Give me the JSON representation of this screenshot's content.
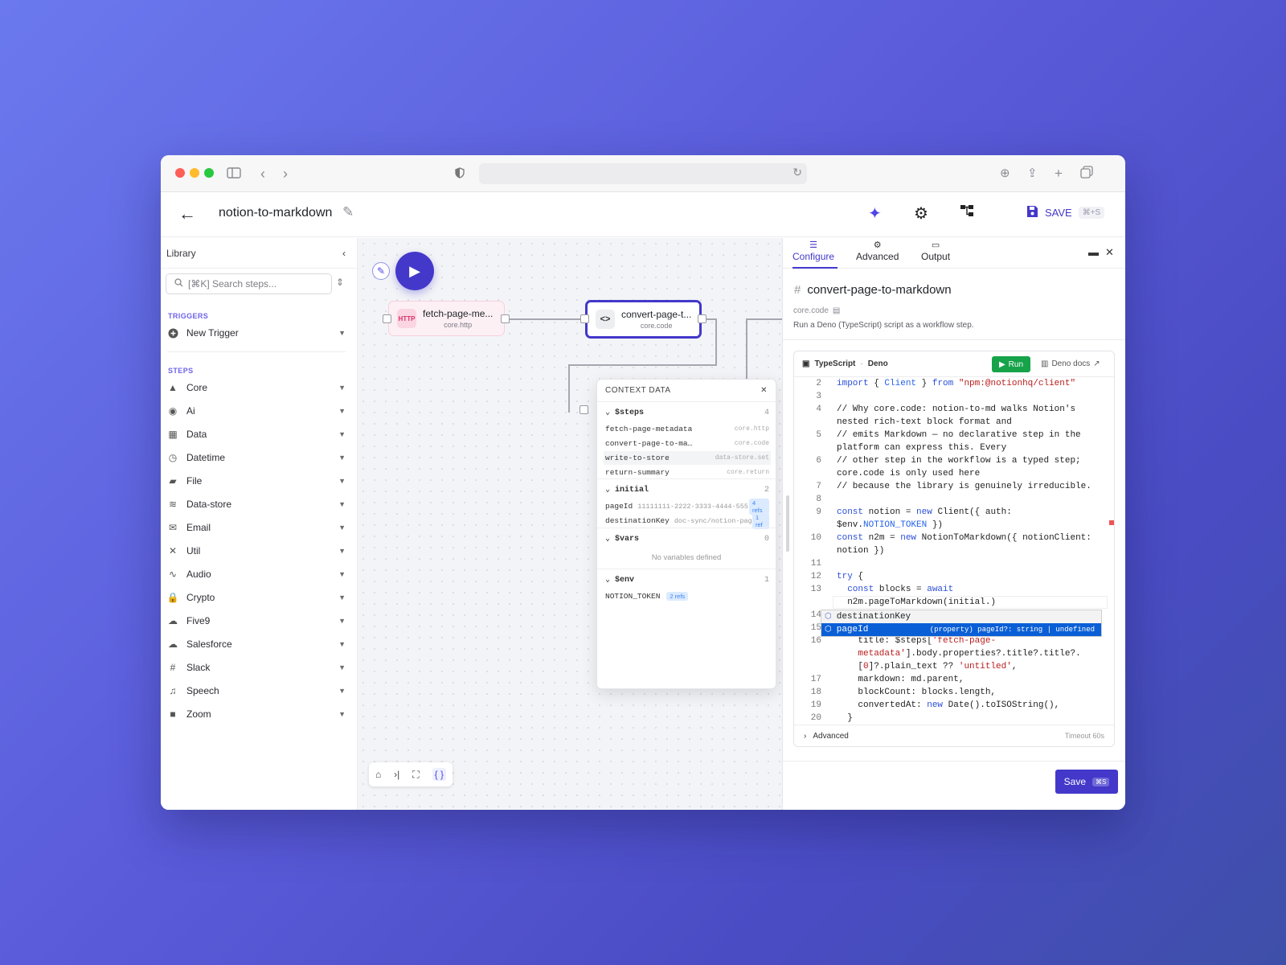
{
  "app": {
    "title": "notion-to-markdown",
    "save_label": "SAVE",
    "save_shortcut": "⌘+S",
    "accent": "#4338ca"
  },
  "sidebar": {
    "title": "Library",
    "search_placeholder": "[⌘K] Search steps...",
    "triggers_label": "TRIGGERS",
    "new_trigger": "New Trigger",
    "steps_label": "STEPS",
    "items": [
      {
        "label": "Core",
        "icon": "shapes-icon"
      },
      {
        "label": "Ai",
        "icon": "brain-icon"
      },
      {
        "label": "Data",
        "icon": "table-icon"
      },
      {
        "label": "Datetime",
        "icon": "clock-icon"
      },
      {
        "label": "File",
        "icon": "folder-icon"
      },
      {
        "label": "Data-store",
        "icon": "database-icon"
      },
      {
        "label": "Email",
        "icon": "envelope-icon"
      },
      {
        "label": "Util",
        "icon": "tools-icon"
      },
      {
        "label": "Audio",
        "icon": "waveform-icon"
      },
      {
        "label": "Crypto",
        "icon": "lock-icon"
      },
      {
        "label": "Five9",
        "icon": "cloud-icon"
      },
      {
        "label": "Salesforce",
        "icon": "salesforce-icon"
      },
      {
        "label": "Slack",
        "icon": "slack-icon"
      },
      {
        "label": "Speech",
        "icon": "speech-icon"
      },
      {
        "label": "Zoom",
        "icon": "video-icon"
      }
    ]
  },
  "canvas": {
    "nodes": [
      {
        "name": "fetch-page-me...",
        "type": "core.http",
        "badge": "HTTP"
      },
      {
        "name": "convert-page-t...",
        "type": "core.code",
        "badge": "<>"
      }
    ],
    "context": {
      "title": "CONTEXT DATA",
      "steps_label": "$steps",
      "steps_count": "4",
      "steps": [
        {
          "name": "fetch-page-metadata",
          "type": "core.http"
        },
        {
          "name": "convert-page-to-ma…",
          "type": "core.code"
        },
        {
          "name": "write-to-store",
          "type": "data-store.set"
        },
        {
          "name": "return-summary",
          "type": "core.return"
        }
      ],
      "initial_label": "initial",
      "initial_count": "2",
      "initial": [
        {
          "name": "pageId",
          "value": "11111111-2222-3333-4444-555...",
          "refs": "4 refs"
        },
        {
          "name": "destinationKey",
          "value": "doc-sync/notion-pag...",
          "refs": "1 ref"
        }
      ],
      "vars_label": "$vars",
      "vars_count": "0",
      "vars_empty": "No variables defined",
      "env_label": "$env",
      "env_count": "1",
      "env": [
        {
          "name": "NOTION_TOKEN",
          "refs": "2 refs"
        }
      ]
    }
  },
  "panel": {
    "tabs": [
      "Configure",
      "Advanced",
      "Output"
    ],
    "step_name": "convert-page-to-markdown",
    "step_type": "core.code",
    "description": "Run a Deno (TypeScript) script as a workflow step.",
    "editor": {
      "language": "TypeScript",
      "runtime": "Deno",
      "run_label": "Run",
      "docs_label": "Deno docs",
      "footer_label": "Advanced",
      "timeout": "Timeout 60s",
      "autocomplete": [
        {
          "label": "destinationKey",
          "detail": ""
        },
        {
          "label": "pageId",
          "detail": "(property) pageId?: string | undefined"
        }
      ]
    },
    "save_label": "Save",
    "save_shortcut": "⌘S"
  }
}
